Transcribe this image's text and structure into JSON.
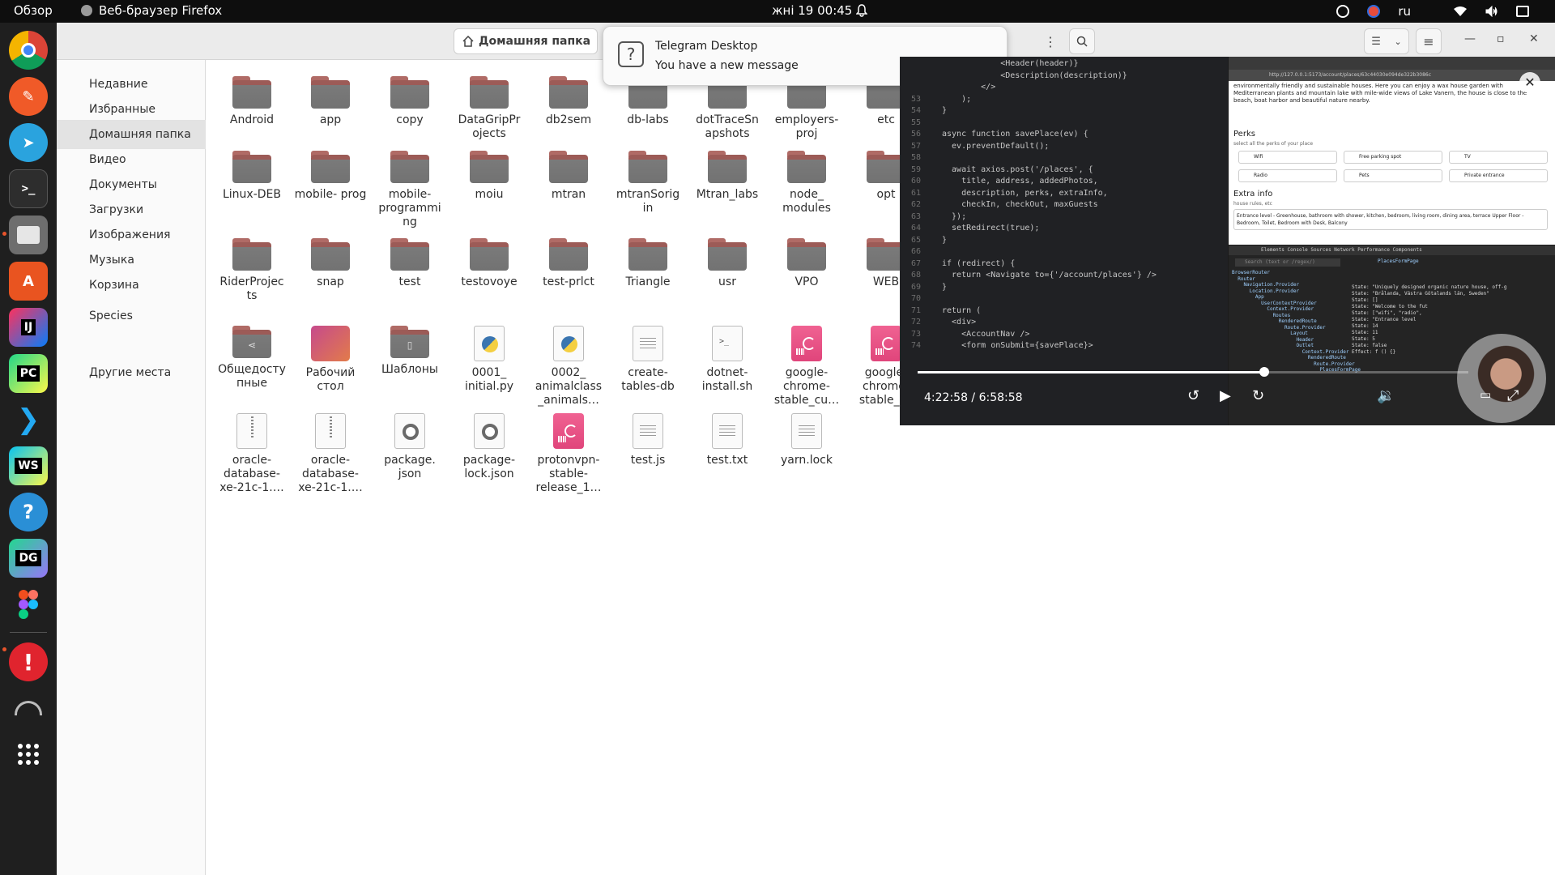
{
  "topbar": {
    "overview": "Обзор",
    "app_name": "Веб-браузер Firefox",
    "clock": "жні 19  00:45",
    "lang": "ru"
  },
  "dock": {
    "items": [
      "chrome",
      "sketch",
      "telegram",
      "terminal",
      "files",
      "app-center",
      "intellij",
      "pycharm",
      "vscode",
      "webstorm",
      "help",
      "datagrip",
      "figma",
      "error-reporter",
      "dock-app",
      "show-apps"
    ]
  },
  "files_window": {
    "path": "Домашняя папка",
    "sidebar": [
      {
        "label": "Недавние"
      },
      {
        "label": "Избранные"
      },
      {
        "label": "Домашняя папка"
      },
      {
        "label": "Видео"
      },
      {
        "label": "Документы"
      },
      {
        "label": "Загрузки"
      },
      {
        "label": "Изображения"
      },
      {
        "label": "Музыка"
      },
      {
        "label": "Корзина"
      },
      {
        "label": "Species"
      },
      {
        "label": "Другие места"
      }
    ],
    "items": [
      {
        "name": "Android",
        "type": "folder"
      },
      {
        "name": "app",
        "type": "folder"
      },
      {
        "name": "copy",
        "type": "folder"
      },
      {
        "name": "DataGripPr ojects",
        "type": "folder"
      },
      {
        "name": "db2sem",
        "type": "folder"
      },
      {
        "name": "db-labs",
        "type": "folder"
      },
      {
        "name": "dotTraceSn apshots",
        "type": "folder"
      },
      {
        "name": "employers- proj",
        "type": "folder"
      },
      {
        "name": "etc",
        "type": "folder"
      },
      {
        "name": "Linux-DEB",
        "type": "folder"
      },
      {
        "name": "mobile- prog",
        "type": "folder"
      },
      {
        "name": "mobile- programmi ng",
        "type": "folder"
      },
      {
        "name": "moiu",
        "type": "folder"
      },
      {
        "name": "mtran",
        "type": "folder"
      },
      {
        "name": "mtranSorig in",
        "type": "folder"
      },
      {
        "name": "Mtran_labs",
        "type": "folder"
      },
      {
        "name": "node_ modules",
        "type": "folder"
      },
      {
        "name": "opt",
        "type": "folder"
      },
      {
        "name": "RiderProjec ts",
        "type": "folder"
      },
      {
        "name": "snap",
        "type": "folder"
      },
      {
        "name": "test",
        "type": "folder"
      },
      {
        "name": "testovoye",
        "type": "folder"
      },
      {
        "name": "test-prlct",
        "type": "folder"
      },
      {
        "name": "Triangle",
        "type": "folder"
      },
      {
        "name": "usr",
        "type": "folder"
      },
      {
        "name": "VPO",
        "type": "folder"
      },
      {
        "name": "WEB",
        "type": "folder"
      },
      {
        "name": "Общедосту пные",
        "type": "shared"
      },
      {
        "name": "Рабочий стол",
        "type": "desktop"
      },
      {
        "name": "Шаблоны",
        "type": "templates"
      },
      {
        "name": "0001_ initial.py",
        "type": "python"
      },
      {
        "name": "0002_ animalclass _animals…",
        "type": "python"
      },
      {
        "name": "create- tables-db",
        "type": "text"
      },
      {
        "name": "dotnet- install.sh",
        "type": "script"
      },
      {
        "name": "google- chrome- stable_cu…",
        "type": "deb"
      },
      {
        "name": "google- chrome- stable_cu",
        "type": "deb"
      },
      {
        "name": "oracle- database- xe-21c-1.…",
        "type": "zip"
      },
      {
        "name": "oracle- database- xe-21c-1.…",
        "type": "zip"
      },
      {
        "name": "package. json",
        "type": "json"
      },
      {
        "name": "package- lock.json",
        "type": "json"
      },
      {
        "name": "protonvpn- stable- release_1…",
        "type": "deb"
      },
      {
        "name": "test.js",
        "type": "text"
      },
      {
        "name": "test.txt",
        "type": "text"
      },
      {
        "name": "yarn.lock",
        "type": "text"
      }
    ]
  },
  "notification": {
    "title": "Telegram Desktop",
    "body": "You have a new message"
  },
  "video": {
    "time": "4:22:58 / 6:58:58",
    "progress": 0.63,
    "code_lines": [
      {
        "n": "",
        "t": "            <Header(header)}"
      },
      {
        "n": "",
        "t": "            <Description(description)}"
      },
      {
        "n": "",
        "t": "        </>"
      },
      {
        "n": "53",
        "t": "    );"
      },
      {
        "n": "54",
        "t": "}"
      },
      {
        "n": "55",
        "t": ""
      },
      {
        "n": "56",
        "t": "async function savePlace(ev) {"
      },
      {
        "n": "57",
        "t": "  ev.preventDefault();"
      },
      {
        "n": "58",
        "t": ""
      },
      {
        "n": "59",
        "t": "  await axios.post('/places', {"
      },
      {
        "n": "60",
        "t": "    title, address, addedPhotos,"
      },
      {
        "n": "61",
        "t": "    description, perks, extraInfo,"
      },
      {
        "n": "62",
        "t": "    checkIn, checkOut, maxGuests"
      },
      {
        "n": "63",
        "t": "  });"
      },
      {
        "n": "64",
        "t": "  setRedirect(true);"
      },
      {
        "n": "65",
        "t": "}"
      },
      {
        "n": "66",
        "t": ""
      },
      {
        "n": "67",
        "t": "if (redirect) {"
      },
      {
        "n": "68",
        "t": "  return <Navigate to={'/account/places'} />"
      },
      {
        "n": "69",
        "t": "}"
      },
      {
        "n": "70",
        "t": ""
      },
      {
        "n": "71",
        "t": "return ("
      },
      {
        "n": "72",
        "t": "  <div>"
      },
      {
        "n": "73",
        "t": "    <AccountNav />"
      },
      {
        "n": "74",
        "t": "    <form onSubmit={savePlace}>"
      }
    ],
    "browser": {
      "url": "http://127.0.0.1:5173/account/places/63c44030e094de322b3086c",
      "desc": "environmentally friendly and sustainable houses. Here you can enjoy a wax house garden with Mediterranean plants and mountain lake with mile-wide views of Lake Vanern, the house is close to the beach, boat harbor and beautiful nature nearby.",
      "perks_title": "Perks",
      "perks_sub": "select all the perks of your place",
      "perks": [
        "Wifi",
        "Free parking spot",
        "TV",
        "Radio",
        "Pets",
        "Private entrance"
      ],
      "extra_title": "Extra info",
      "extra_sub": "house rules, etc",
      "extra_text": "Entrance level - Greenhouse, bathroom with shower, kitchen, bedroom, living room, dining area, terrace Upper Floor - Bedroom, Toilet, Bedroom with Desk, Balcony"
    },
    "devtools": {
      "tabs": "Elements   Console   Sources   Network   Performance   Components",
      "component": "PlacesFormPage",
      "tree": [
        "BrowserRouter",
        "  Router",
        "    Navigation.Provider",
        "      Location.Provider",
        "        App",
        "          UserContextProvider",
        "            Context.Provider",
        "              Routes",
        "                RenderedRoute",
        "                  Route.Provider",
        "                    Layout",
        "                      Header",
        "                      Outlet",
        "                        Context.Provider",
        "                          RenderedRoute",
        "                            Route.Provider",
        "                              PlacesFormPage"
      ],
      "hooks": [
        "State: \"Uniquely designed organic nature house, off-g",
        "State: \"Brålanda, Västra Götalands län, Sweden\"",
        "State: []",
        "State: \"Welcome to the fut",
        "State: [\"wifi\", \"radio\",",
        "State: \"Entrance level",
        "State: 14",
        "State: 11",
        "State: 5",
        "State: false",
        "Effect: f () {}"
      ]
    }
  }
}
